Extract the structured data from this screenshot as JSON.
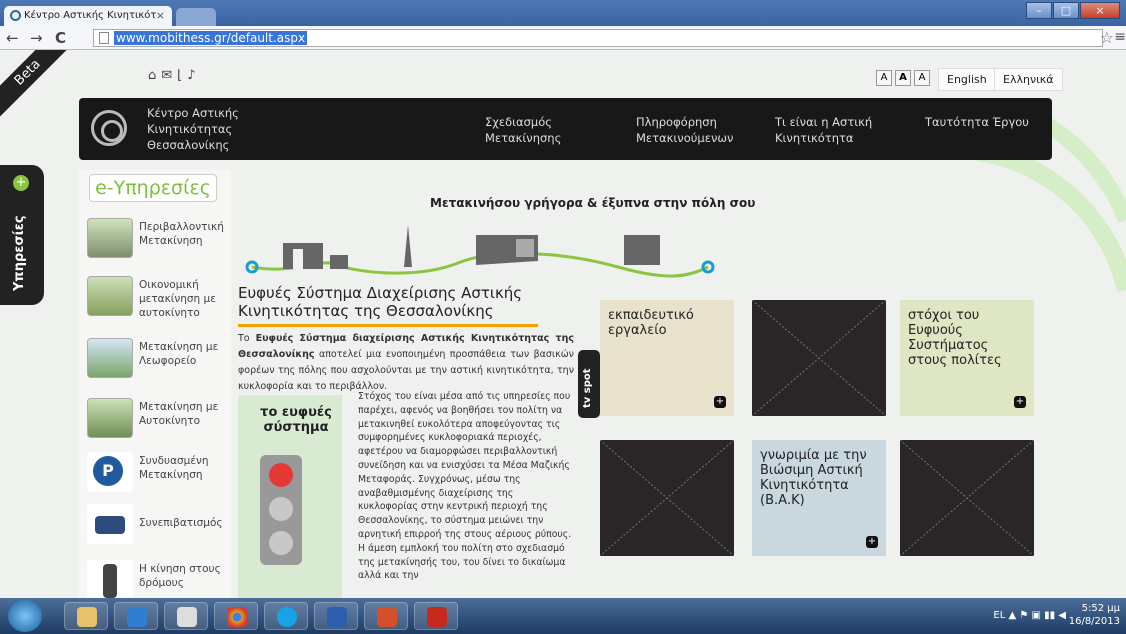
{
  "browser": {
    "tab_title": "Κέντρο Αστικής Κινητικότ",
    "url": "www.mobithess.gr/default.aspx"
  },
  "page": {
    "beta": "Beta",
    "font_controls": [
      "A",
      "A",
      "A"
    ],
    "langs": [
      "English",
      "Ελληνικά"
    ],
    "brand": [
      "Κέντρο Αστικής",
      "Κινητικότητας",
      "Θεσσαλονίκης"
    ],
    "menu": [
      {
        "l1": "Σχεδιασμός",
        "l2": "Μετακίνησης"
      },
      {
        "l1": "Πληροφόρηση",
        "l2": "Μετακινούμενων"
      },
      {
        "l1": "Τι είναι η Αστική",
        "l2": "Κινητικότητα"
      },
      {
        "l1": "Ταυτότητα Έργου",
        "l2": ""
      }
    ],
    "side_tab": "Υπηρεσίες",
    "eservices": "e-Υπηρεσίες",
    "services": [
      {
        "label": "Περιβαλλοντική Μετακίνηση",
        "icon": "car-tree-icon"
      },
      {
        "label": "Οικονομική μετακίνηση με αυτοκίνητο",
        "icon": "money-car-icon"
      },
      {
        "label": "Μετακίνηση με Λεωφορείο",
        "icon": "bus-icon"
      },
      {
        "label": "Μετακίνηση με Αυτοκίνητο",
        "icon": "road-car-icon"
      },
      {
        "label": "Συνδυασμένη Μετακίνηση",
        "icon": "park-ride-icon"
      },
      {
        "label": "Συνεπιβατισμός",
        "icon": "carpool-icon"
      },
      {
        "label": "Η κίνηση στους δρόμους",
        "icon": "traffic-light-icon"
      }
    ],
    "tagline": "Μετακινήσου γρήγορα & έξυπνα στην πόλη σου",
    "title": "Ευφυές Σύστημα Διαχείρισης Αστικής Κινητικότητας της Θεσσαλονίκης",
    "intro_pre": "Το ",
    "intro_bold": "Ευφυές Σύστημα διαχείρισης Αστικής Κινητικότητας της Θεσσαλονίκης",
    "intro_post": " αποτελεί μια ενοποιημένη προσπάθεια των βασικών φορέων της πόλης που ασχολούνται με την αστική κινητικότητα, την κυκλοφορία και το περιβάλλον.",
    "smart_title": "το ευφυές σύστημα",
    "body_text": "Στόχος του είναι μέσα από τις υπηρεσίες που παρέχει, αφενός να βοηθήσει τον πολίτη να μετακινηθεί ευκολότερα αποφεύγοντας τις συμφορημένες κυκλοφοριακά περιοχές, αφετέρου να διαμορφώσει περιβαλλοντική συνείδηση και να ενισχύσει τα Μέσα Μαζικής Μεταφοράς. Συγχρόνως, μέσω της αναβαθμισμένης διαχείρισης της κυκλοφορίας στην κεντρική περιοχή της Θεσσαλονίκης, το σύστημα μειώνει την αρνητική επιρροή της στους αέριους ρύπους. Η άμεση εμπλοκή του πολίτη στο σχεδιασμό της μετακίνησής του, του δίνει το δικαίωμα αλλά και την",
    "tv_spot": "tv spot",
    "tiles": {
      "t1": "εκπαιδευτικό εργαλείο",
      "t2": "στόχοι του Ευφυούς Συστήματος στους πολίτες",
      "t3": "γνωριμία με την Βιώσιμη Αστική Κινητικότητα (Β.Α.Κ)"
    }
  },
  "taskbar": {
    "lang": "EL",
    "time": "5:52 μμ",
    "date": "16/8/2013"
  }
}
